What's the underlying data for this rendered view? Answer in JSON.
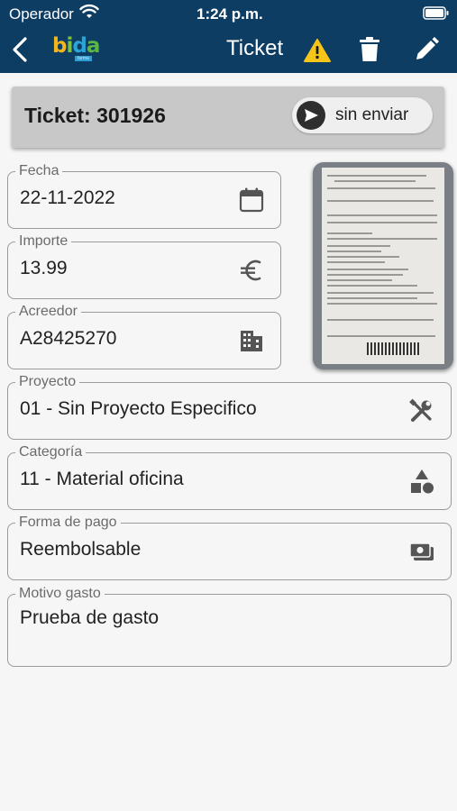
{
  "status_bar": {
    "carrier": "Operador",
    "time": "1:24 p.m."
  },
  "nav": {
    "title": "Ticket",
    "logo": {
      "b": "b",
      "i": "i",
      "d": "d",
      "a": "a",
      "sub": "farma"
    },
    "icons": [
      "chevron-left-icon",
      "warning-icon",
      "trash-icon",
      "pencil-icon"
    ]
  },
  "ticket": {
    "title": "Ticket: 301926",
    "send_status": "sin enviar"
  },
  "fields": {
    "fecha": {
      "label": "Fecha",
      "value": "22-11-2022",
      "icon": "calendar-icon"
    },
    "importe": {
      "label": "Importe",
      "value": "13.99",
      "icon": "euro-icon"
    },
    "acreedor": {
      "label": "Acreedor",
      "value": "A28425270",
      "icon": "building-icon"
    },
    "proyecto": {
      "label": "Proyecto",
      "value": "01 - Sin Proyecto Especifico",
      "icon": "tools-icon"
    },
    "categoria": {
      "label": "Categoría",
      "value": "11 - Material oficina",
      "icon": "shapes-icon"
    },
    "forma_pago": {
      "label": "Forma de pago",
      "value": "Reembolsable",
      "icon": "cash-icon"
    },
    "motivo": {
      "label": "Motivo gasto",
      "value": "Prueba de gasto"
    }
  },
  "colors": {
    "nav_bg": "#0d3d63",
    "warning": "#f5c518",
    "field_border": "#9a9a9a"
  }
}
